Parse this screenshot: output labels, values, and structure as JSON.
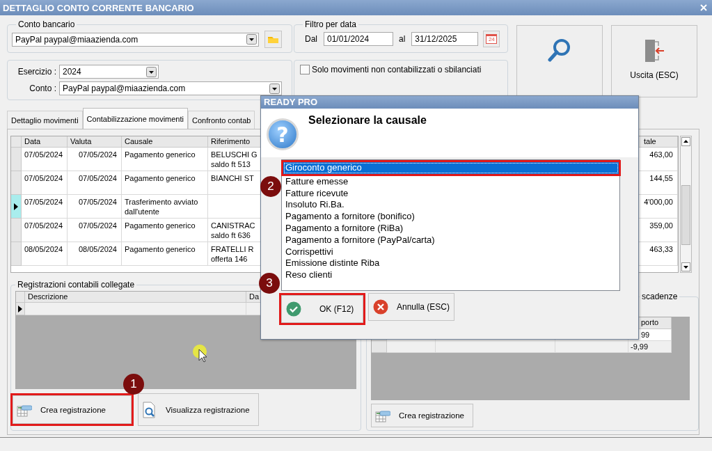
{
  "window": {
    "title": "DETTAGLIO CONTO CORRENTE BANCARIO"
  },
  "conto_bancario": {
    "label": "Conto bancario",
    "value": "PayPal paypal@miaazienda.com"
  },
  "filtro_data": {
    "label": "Filtro per data",
    "from_label": "Dal",
    "from": "01/01/2024",
    "to_label": "al",
    "to": "31/12/2025",
    "calendar_day": "24"
  },
  "esercizio": {
    "label": "Esercizio :",
    "value": "2024"
  },
  "conto": {
    "label": "Conto :",
    "value": "PayPal paypal@miaazienda.com"
  },
  "filter_checkbox": {
    "label": "Solo movimenti non contabilizzati o sbilanciati",
    "checked": false
  },
  "exit_button": {
    "label": "Uscita (ESC)"
  },
  "tabs": [
    {
      "label": "Dettaglio movimenti",
      "selected": false
    },
    {
      "label": "Contabilizzazione movimenti",
      "selected": true
    },
    {
      "label": "Confronto contab",
      "selected": false
    }
  ],
  "movements": {
    "columns": [
      "Data",
      "Valuta",
      "Causale",
      "Riferimento",
      "tale"
    ],
    "rows": [
      {
        "data": "07/05/2024",
        "valuta": "07/05/2024",
        "causale": "Pagamento generico",
        "riferimento": "BELUSCHI G\nsaldo ft 513",
        "totale": "463,00",
        "current": false
      },
      {
        "data": "07/05/2024",
        "valuta": "07/05/2024",
        "causale": "Pagamento generico",
        "riferimento": "BIANCHI ST",
        "totale": "144,55",
        "current": false
      },
      {
        "data": "07/05/2024",
        "valuta": "07/05/2024",
        "causale": "Trasferimento avviato dall'utente",
        "totale": "4'000,00",
        "current": true
      },
      {
        "data": "07/05/2024",
        "valuta": "07/05/2024",
        "causale": "Pagamento generico",
        "riferimento": "CANISTRAC\nsaldo ft 636",
        "totale": "359,00",
        "current": false
      },
      {
        "data": "08/05/2024",
        "valuta": "08/05/2024",
        "causale": "Pagamento generico",
        "riferimento": "FRATELLI R\nofferta 146",
        "totale": "463,33",
        "current": false
      }
    ]
  },
  "linked": {
    "title": "Registrazioni contabili collegate",
    "columns": [
      "Descrizione",
      "Da"
    ],
    "buttons": [
      {
        "label": "Crea registrazione",
        "kind": "create",
        "highlighted": true,
        "step": "1"
      },
      {
        "label": "Visualizza registrazione",
        "kind": "view",
        "highlighted": false
      }
    ]
  },
  "scadenze": {
    "title": "scadenze",
    "column": "porto",
    "values": [
      "99",
      "-9,99"
    ],
    "button": {
      "label": "Crea registrazione"
    }
  },
  "dialog": {
    "title": "READY PRO",
    "icon_glyph": "?",
    "heading": "Selezionare la causale",
    "items": [
      {
        "label": "Giroconto generico",
        "selected": true,
        "highlighted": true,
        "step": "2"
      },
      {
        "label": "Fatture emesse",
        "selected": false,
        "highlighted": false
      },
      {
        "label": "Fatture ricevute",
        "selected": false,
        "highlighted": false
      },
      {
        "label": "Insoluto Ri.Ba.",
        "selected": false,
        "highlighted": false
      },
      {
        "label": "Pagamento a fornitore (bonifico)",
        "selected": false,
        "highlighted": false
      },
      {
        "label": "Pagamento a fornitore (RiBa)",
        "selected": false,
        "highlighted": false
      },
      {
        "label": "Pagamento a fornitore (PayPal/carta)",
        "selected": false,
        "highlighted": false
      },
      {
        "label": "Corrispettivi",
        "selected": false,
        "highlighted": false
      },
      {
        "label": "Emissione distinte Riba",
        "selected": false,
        "highlighted": false
      },
      {
        "label": "Reso clienti",
        "selected": false,
        "highlighted": false
      }
    ],
    "buttons": [
      {
        "label": "OK (F12)",
        "kind": "ok",
        "highlighted": true,
        "step": "3"
      },
      {
        "label": "Annulla (ESC)",
        "kind": "cancel",
        "highlighted": false
      }
    ]
  }
}
